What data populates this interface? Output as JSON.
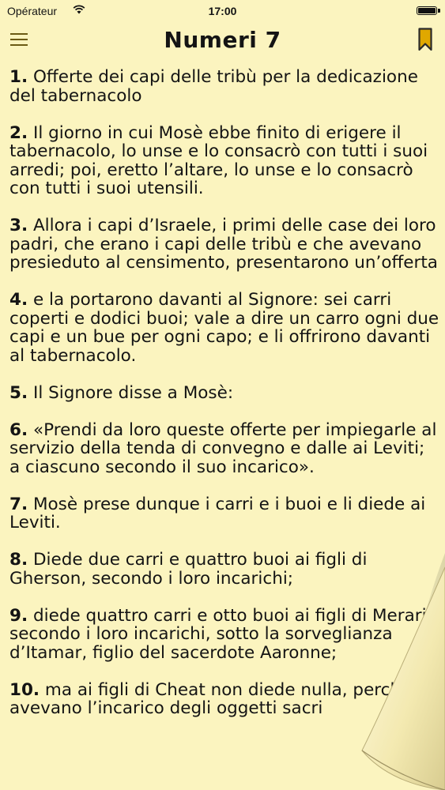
{
  "status_bar": {
    "carrier": "Opérateur",
    "time": "17:00"
  },
  "nav": {
    "title": "Numeri 7",
    "menu_icon": "hamburger-icon",
    "bookmark_icon": "bookmark-icon",
    "bookmark_color": "#e0a800"
  },
  "verses": [
    {
      "num": "1.",
      "text": " Offerte dei capi delle tribù per la dedicazione del tabernacolo"
    },
    {
      "num": "2.",
      "text": " Il giorno in cui Mosè ebbe finito di erigere il tabernacolo, lo unse e lo consacrò con tutti i suoi arredi; poi, eretto l’altare, lo unse e lo consacrò con tutti i suoi utensili."
    },
    {
      "num": "3.",
      "text": " Allora i capi d’Israele, i primi delle case dei loro padri, che erano i capi delle tribù e che avevano presieduto al censimento, presentarono un’offerta"
    },
    {
      "num": "4.",
      "text": " e la portarono davanti al Signore: sei carri coperti e dodici buoi; vale a dire un carro ogni due capi e un bue per ogni capo; e li offrirono davanti al tabernacolo."
    },
    {
      "num": "5.",
      "text": " Il Signore disse a Mosè:"
    },
    {
      "num": "6.",
      "text": " «Prendi da loro queste offerte per impiegarle al servizio della tenda di convegno e dalle ai Leviti; a ciascuno secondo il suo incarico»."
    },
    {
      "num": "7.",
      "text": " Mosè prese dunque i carri e i buoi e li diede ai Leviti."
    },
    {
      "num": "8.",
      "text": " Diede due carri e quattro buoi ai figli di Gherson, secondo i loro incarichi;"
    },
    {
      "num": "9.",
      "text": " diede quattro carri e otto buoi ai figli di Merari, secondo i loro incarichi, sotto la sorveglianza d’Itamar, figlio del sacerdote Aaronne;"
    },
    {
      "num": "10.",
      "text": " ma ai figli di Cheat non diede nulla, perché avevano l’incarico degli oggetti sacri"
    }
  ]
}
